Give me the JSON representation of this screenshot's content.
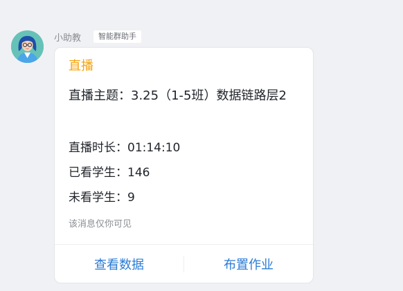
{
  "sender": {
    "name": "小助教",
    "tag": "智能群助手"
  },
  "card": {
    "title": "直播",
    "topic": "直播主题：3.25（1-5班）数据链路层2",
    "duration": "直播时长：01:14:10",
    "watched": "已看学生：146",
    "unwatched": "未看学生：9",
    "notice": "该消息仅你可见"
  },
  "actions": {
    "view_data": "查看数据",
    "assign_homework": "布置作业"
  },
  "colors": {
    "title_accent": "#f4a40f",
    "action_link": "#2a7bd6",
    "background": "#f0f1f4"
  }
}
